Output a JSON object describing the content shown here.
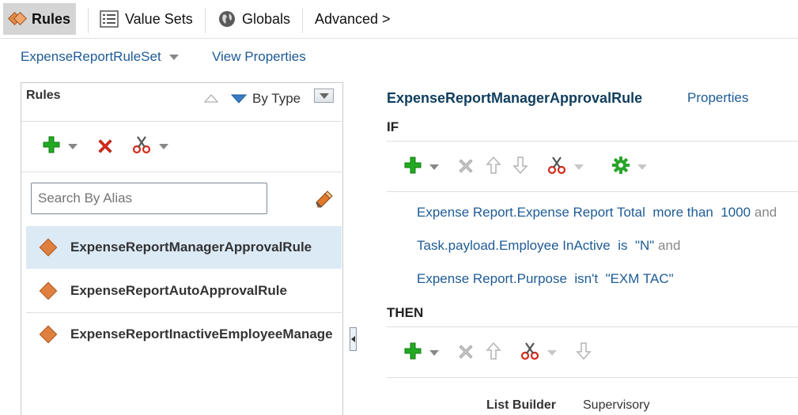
{
  "tabs": {
    "rules": "Rules",
    "value_sets": "Value Sets",
    "globals": "Globals",
    "advanced": "Advanced >"
  },
  "ruleset": {
    "name": "ExpenseReportRuleSet",
    "view_properties": "View Properties"
  },
  "left_panel": {
    "title": "Rules",
    "sort_label": "By Type",
    "search_placeholder": "Search By Alias",
    "rules": [
      {
        "name": "ExpenseReportManagerApprovalRule",
        "selected": true
      },
      {
        "name": "ExpenseReportAutoApprovalRule",
        "selected": false
      },
      {
        "name": "ExpenseReportInactiveEmployeeManage",
        "selected": false
      }
    ]
  },
  "rule_detail": {
    "name": "ExpenseReportManagerApprovalRule",
    "properties_link": "Properties",
    "if_label": "IF",
    "then_label": "THEN",
    "conditions": [
      {
        "left": "Expense Report.Expense Report Total",
        "op": "more than",
        "right": "1000",
        "conj": "and"
      },
      {
        "left": "Task.payload.Employee InActive",
        "op": "is",
        "right": "\"N\"",
        "conj": "and"
      },
      {
        "left": "Expense Report.Purpose",
        "op": "isn't",
        "right": "\"EXM TAC\"",
        "conj": ""
      }
    ],
    "action_partial": {
      "label": "List Builder",
      "value": "Supervisory"
    }
  },
  "colors": {
    "link": "#1e5b96",
    "selected_row": "#dceaf6",
    "add_green": "#1a9c1a",
    "delete_red": "#d42a1a"
  }
}
